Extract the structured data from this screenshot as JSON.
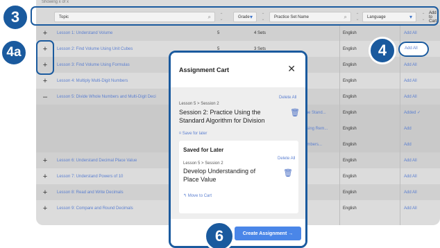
{
  "table": {
    "showing": "Showing x of x",
    "header": {
      "topic": "Topic",
      "grade": "Grade",
      "practice_set": "Practice Set Name",
      "language": "Language",
      "add_to_cart": "Add to Cart"
    },
    "rows": [
      {
        "sign": "+",
        "topic": "Lesson 1: Understand Volume",
        "grade": "5",
        "sets": "4 Sets",
        "language": "English",
        "action": "Add All"
      },
      {
        "sign": "+",
        "topic": "Lesson 2: Find Volume Using Unit Cubes",
        "grade": "5",
        "sets": "3 Sets",
        "language": "English",
        "action": "Add All"
      },
      {
        "sign": "+",
        "topic": "Lesson 3: Find Volume Using Formulas",
        "grade": "",
        "sets": "",
        "language": "English",
        "action": "Add All"
      },
      {
        "sign": "+",
        "topic": "Lesson 4: Multiply Multi-Digit Numbers",
        "grade": "",
        "sets": "",
        "language": "English",
        "action": "Add All"
      },
      {
        "sign": "–",
        "topic": "Lesson 5: Divide Whole Numbers and Multi-Digit Deci",
        "grade": "",
        "sets": "",
        "language": "English",
        "action": "Add All"
      },
      {
        "sign": "",
        "topic": "",
        "extra": "the Stand...",
        "language": "English",
        "action": "Added ✓"
      },
      {
        "sign": "",
        "topic": "",
        "extra": "ssing Rem...",
        "language": "English",
        "action": "Add"
      },
      {
        "sign": "",
        "topic": "",
        "extra": "umbers...",
        "language": "English",
        "action": "Add"
      },
      {
        "sign": "+",
        "topic": "Lesson 6: Understand Decimal Place Value",
        "grade": "",
        "sets": "",
        "language": "English",
        "action": "Add All"
      },
      {
        "sign": "+",
        "topic": "Lesson 7: Understand Powers of 10",
        "grade": "",
        "sets": "",
        "language": "English",
        "action": "Add All"
      },
      {
        "sign": "+",
        "topic": "Lesson 8: Read and Write Decimals",
        "grade": "",
        "sets": "",
        "language": "English",
        "action": "Add All"
      },
      {
        "sign": "+",
        "topic": "Lesson 9: Compare and Round Decimals",
        "grade": "",
        "sets": "",
        "language": "English",
        "action": "Add All"
      }
    ]
  },
  "callouts": {
    "c3": "3",
    "c4a": "4a",
    "c4": "4",
    "c6": "6"
  },
  "cart": {
    "title": "Assignment Cart",
    "close": "✕",
    "delete_all": "Delete All",
    "item_crumb": "Lesson 5 > Session 2",
    "item_title": "Session 2: Practice Using the Standard Algorithm for Division",
    "save_for_later": "Save for later",
    "saved_title": "Saved for Later",
    "saved_delete_all": "Delete All",
    "saved_crumb": "Lesson 5 > Session 2",
    "saved_item_title": "Develop Understanding of Place Value",
    "move_to_cart": "Move to Cart",
    "create_button": "Create Assignment →"
  },
  "colors": {
    "accent": "#1a5a9e",
    "link": "#5b7fd0",
    "button": "#4a86e8"
  }
}
